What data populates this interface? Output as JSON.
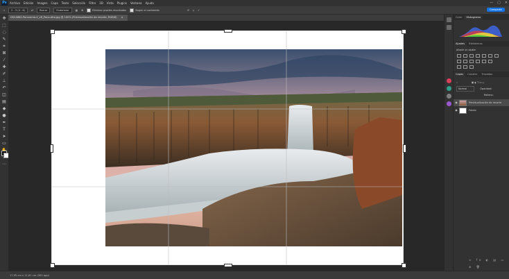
{
  "menubar": {
    "logo": "Ps",
    "items": [
      "Archivo",
      "Edición",
      "Imagen",
      "Capa",
      "Texto",
      "Selección",
      "Filtro",
      "3D",
      "Vista",
      "Plugins",
      "Ventana",
      "Ayuda"
    ],
    "window_controls": [
      "—",
      "▢",
      "✕"
    ]
  },
  "options": {
    "ratio": "2 : 3 (4 : 6)",
    "clear": "Borrar",
    "straighten": "Enderezar",
    "delete_pixels": "Eliminar píxeles recortados",
    "content_aware": "Según el contenido"
  },
  "document": {
    "tab_title": "DSC4662-Panorama-2_vR_Pano-Alta.jpg @ 100% (Previsualización de recorte, RGB/8)",
    "close": "×"
  },
  "status": {
    "zoom": "17,95 cm x 11,81 cm (300 ppp)"
  },
  "panels": {
    "share_label": "Compartir",
    "top_tabs": [
      "Color",
      "Histograma"
    ],
    "adjust_tabs": [
      "Ajustes",
      "Bibliotecas"
    ],
    "adjust_label": "Añadir un ajuste",
    "layer_tabs": [
      "Capas",
      "Canales",
      "Trazados"
    ],
    "layers": [
      {
        "name": "Previsualización de recorte"
      },
      {
        "name": "Fondo"
      }
    ],
    "blend_mode": "Normal",
    "opacity_label": "Opacidad:",
    "fill_label": "Relleno:"
  },
  "colors": {
    "ui_dark": "#323232",
    "canvas_bg": "#282828",
    "accent": "#1473e6"
  }
}
